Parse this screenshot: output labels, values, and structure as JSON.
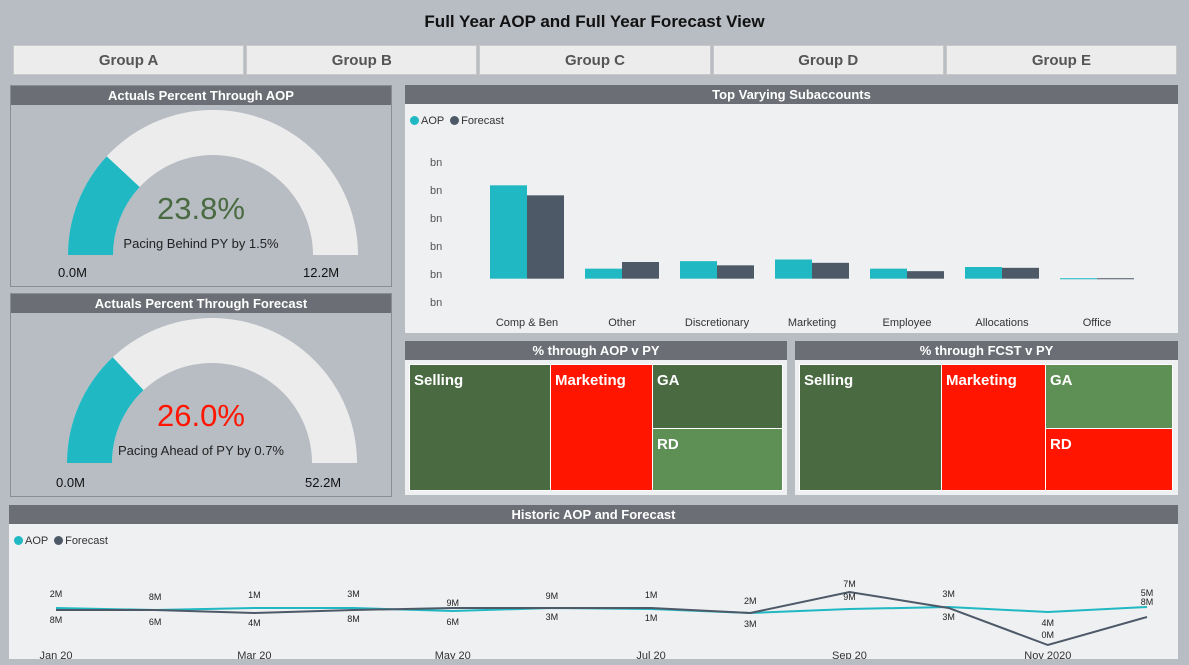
{
  "page": {
    "title": "Full Year AOP and Full Year Forecast View"
  },
  "tabs": [
    "Group A",
    "Group B",
    "Group C",
    "Group D",
    "Group E"
  ],
  "colors": {
    "aop": "#1fb8c3",
    "forecast": "#4e5968",
    "dark_green": "#4a6b42",
    "light_green": "#5e8f55",
    "red": "#ff1500",
    "gauge_track": "#ececec"
  },
  "gauge_aop": {
    "title": "Actuals Percent Through AOP",
    "value_label": "23.8%",
    "fill_fraction": 0.238,
    "value_color": "#4a6b42",
    "subtitle": "Pacing Behind PY by 1.5%",
    "min_label": "0.0M",
    "max_label": "12.2M"
  },
  "gauge_fcst": {
    "title": "Actuals Percent Through Forecast",
    "value_label": "26.0%",
    "fill_fraction": 0.26,
    "value_color": "#ff1500",
    "subtitle": "Pacing Ahead of PY by 0.7%",
    "min_label": "0.0M",
    "max_label": "52.2M"
  },
  "bar_chart": {
    "title": "Top Varying Subaccounts",
    "legend": [
      "AOP",
      "Forecast"
    ],
    "y_tick_labels": [
      "bn",
      "bn",
      "bn",
      "bn",
      "bn",
      "bn"
    ]
  },
  "chart_data": [
    {
      "type": "bar",
      "title": "Top Varying Subaccounts",
      "categories": [
        "Comp & Ben",
        "Other",
        "Discretionary",
        "Marketing",
        "Employee Related",
        "Allocations",
        "Office Supplies"
      ],
      "series": [
        {
          "name": "AOP",
          "values": [
            112,
            12,
            21,
            23,
            12,
            14,
            0.5
          ]
        },
        {
          "name": "Forecast",
          "values": [
            100,
            20,
            16,
            19,
            9,
            13,
            0.5
          ]
        }
      ],
      "ylim": [
        -28,
        140
      ],
      "grid": false,
      "legend": "top-left"
    },
    {
      "type": "line",
      "title": "Historic AOP and Forecast",
      "x": [
        "Jan 20",
        "Feb 20",
        "Mar 20",
        "Apr 20",
        "May 20",
        "Jun 20",
        "Jul 20",
        "Aug 20",
        "Sep 20",
        "Oct 20",
        "Nov 2020",
        "Dec 20"
      ],
      "x_tick_labels": [
        "Jan 20",
        "Mar 20",
        "May 20",
        "Jul 20",
        "Sep 20",
        "Nov 2020"
      ],
      "series": [
        {
          "name": "AOP",
          "values": [
            2,
            8,
            1,
            3,
            9,
            9,
            1,
            2,
            9,
            3,
            4,
            5
          ],
          "labels": [
            "2M",
            "8M",
            "1M",
            "3M",
            "9M",
            "9M",
            "1M",
            "2M",
            "9M",
            "3M",
            "4M",
            "5M"
          ]
        },
        {
          "name": "Forecast",
          "values": [
            8,
            6,
            4,
            8,
            6,
            3,
            1,
            3,
            7,
            3,
            0,
            8
          ],
          "labels": [
            "8M",
            "6M",
            "4M",
            "8M",
            "6M",
            "3M",
            "1M",
            "3M",
            "7M",
            "3M",
            "0M",
            "8M"
          ]
        }
      ],
      "legend": "top-left"
    }
  ],
  "treemap_aop": {
    "title": "% through AOP v PY",
    "cells": [
      {
        "label": "Selling",
        "color": "#4a6b42"
      },
      {
        "label": "Marketing",
        "color": "#ff1500"
      },
      {
        "label": "GA",
        "color": "#4a6b42"
      },
      {
        "label": "RD",
        "color": "#5e8f55"
      }
    ]
  },
  "treemap_fcst": {
    "title": "% through FCST v PY",
    "cells": [
      {
        "label": "Selling",
        "color": "#4a6b42"
      },
      {
        "label": "Marketing",
        "color": "#ff1500"
      },
      {
        "label": "GA",
        "color": "#5e8f55"
      },
      {
        "label": "RD",
        "color": "#ff1500"
      }
    ]
  },
  "line_chart": {
    "title": "Historic AOP and Forecast",
    "legend": [
      "AOP",
      "Forecast"
    ]
  }
}
